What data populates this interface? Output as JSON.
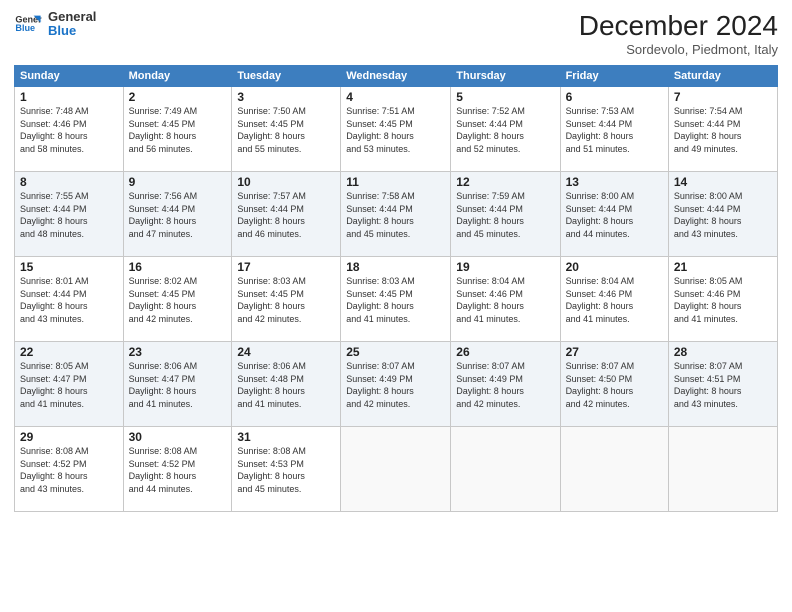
{
  "header": {
    "logo_line1": "General",
    "logo_line2": "Blue",
    "month_title": "December 2024",
    "location": "Sordevolo, Piedmont, Italy"
  },
  "weekdays": [
    "Sunday",
    "Monday",
    "Tuesday",
    "Wednesday",
    "Thursday",
    "Friday",
    "Saturday"
  ],
  "weeks": [
    [
      {
        "day": "1",
        "sunrise": "7:48 AM",
        "sunset": "4:46 PM",
        "daylight": "8 hours and 58 minutes."
      },
      {
        "day": "2",
        "sunrise": "7:49 AM",
        "sunset": "4:45 PM",
        "daylight": "8 hours and 56 minutes."
      },
      {
        "day": "3",
        "sunrise": "7:50 AM",
        "sunset": "4:45 PM",
        "daylight": "8 hours and 55 minutes."
      },
      {
        "day": "4",
        "sunrise": "7:51 AM",
        "sunset": "4:45 PM",
        "daylight": "8 hours and 53 minutes."
      },
      {
        "day": "5",
        "sunrise": "7:52 AM",
        "sunset": "4:44 PM",
        "daylight": "8 hours and 52 minutes."
      },
      {
        "day": "6",
        "sunrise": "7:53 AM",
        "sunset": "4:44 PM",
        "daylight": "8 hours and 51 minutes."
      },
      {
        "day": "7",
        "sunrise": "7:54 AM",
        "sunset": "4:44 PM",
        "daylight": "8 hours and 49 minutes."
      }
    ],
    [
      {
        "day": "8",
        "sunrise": "7:55 AM",
        "sunset": "4:44 PM",
        "daylight": "8 hours and 48 minutes."
      },
      {
        "day": "9",
        "sunrise": "7:56 AM",
        "sunset": "4:44 PM",
        "daylight": "8 hours and 47 minutes."
      },
      {
        "day": "10",
        "sunrise": "7:57 AM",
        "sunset": "4:44 PM",
        "daylight": "8 hours and 46 minutes."
      },
      {
        "day": "11",
        "sunrise": "7:58 AM",
        "sunset": "4:44 PM",
        "daylight": "8 hours and 45 minutes."
      },
      {
        "day": "12",
        "sunrise": "7:59 AM",
        "sunset": "4:44 PM",
        "daylight": "8 hours and 45 minutes."
      },
      {
        "day": "13",
        "sunrise": "8:00 AM",
        "sunset": "4:44 PM",
        "daylight": "8 hours and 44 minutes."
      },
      {
        "day": "14",
        "sunrise": "8:00 AM",
        "sunset": "4:44 PM",
        "daylight": "8 hours and 43 minutes."
      }
    ],
    [
      {
        "day": "15",
        "sunrise": "8:01 AM",
        "sunset": "4:44 PM",
        "daylight": "8 hours and 43 minutes."
      },
      {
        "day": "16",
        "sunrise": "8:02 AM",
        "sunset": "4:45 PM",
        "daylight": "8 hours and 42 minutes."
      },
      {
        "day": "17",
        "sunrise": "8:03 AM",
        "sunset": "4:45 PM",
        "daylight": "8 hours and 42 minutes."
      },
      {
        "day": "18",
        "sunrise": "8:03 AM",
        "sunset": "4:45 PM",
        "daylight": "8 hours and 41 minutes."
      },
      {
        "day": "19",
        "sunrise": "8:04 AM",
        "sunset": "4:46 PM",
        "daylight": "8 hours and 41 minutes."
      },
      {
        "day": "20",
        "sunrise": "8:04 AM",
        "sunset": "4:46 PM",
        "daylight": "8 hours and 41 minutes."
      },
      {
        "day": "21",
        "sunrise": "8:05 AM",
        "sunset": "4:46 PM",
        "daylight": "8 hours and 41 minutes."
      }
    ],
    [
      {
        "day": "22",
        "sunrise": "8:05 AM",
        "sunset": "4:47 PM",
        "daylight": "8 hours and 41 minutes."
      },
      {
        "day": "23",
        "sunrise": "8:06 AM",
        "sunset": "4:47 PM",
        "daylight": "8 hours and 41 minutes."
      },
      {
        "day": "24",
        "sunrise": "8:06 AM",
        "sunset": "4:48 PM",
        "daylight": "8 hours and 41 minutes."
      },
      {
        "day": "25",
        "sunrise": "8:07 AM",
        "sunset": "4:49 PM",
        "daylight": "8 hours and 42 minutes."
      },
      {
        "day": "26",
        "sunrise": "8:07 AM",
        "sunset": "4:49 PM",
        "daylight": "8 hours and 42 minutes."
      },
      {
        "day": "27",
        "sunrise": "8:07 AM",
        "sunset": "4:50 PM",
        "daylight": "8 hours and 42 minutes."
      },
      {
        "day": "28",
        "sunrise": "8:07 AM",
        "sunset": "4:51 PM",
        "daylight": "8 hours and 43 minutes."
      }
    ],
    [
      {
        "day": "29",
        "sunrise": "8:08 AM",
        "sunset": "4:52 PM",
        "daylight": "8 hours and 43 minutes."
      },
      {
        "day": "30",
        "sunrise": "8:08 AM",
        "sunset": "4:52 PM",
        "daylight": "8 hours and 44 minutes."
      },
      {
        "day": "31",
        "sunrise": "8:08 AM",
        "sunset": "4:53 PM",
        "daylight": "8 hours and 45 minutes."
      },
      null,
      null,
      null,
      null
    ]
  ]
}
